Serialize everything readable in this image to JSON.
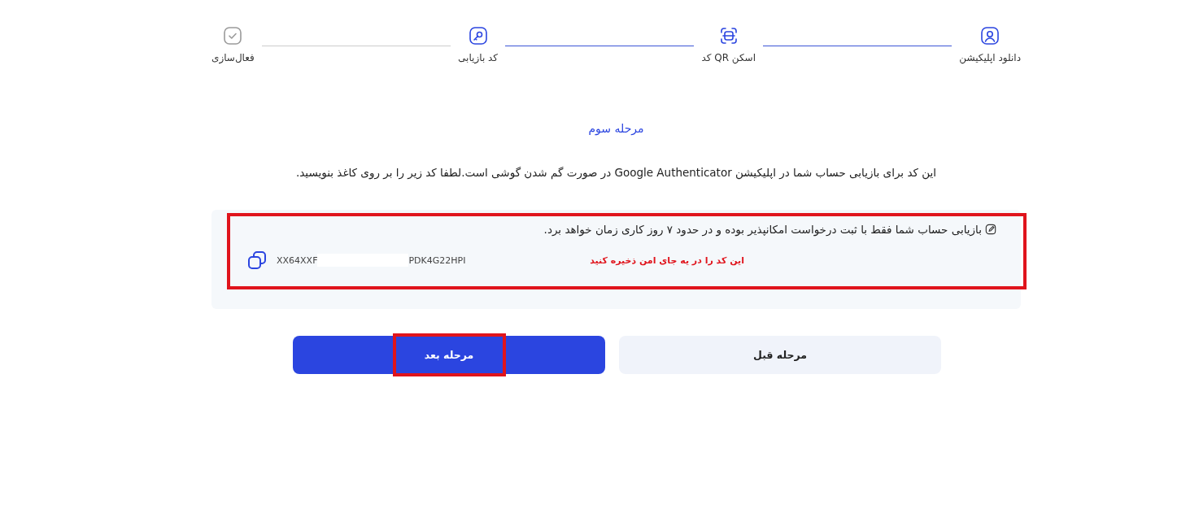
{
  "steps": [
    {
      "label": "دانلود اپلیکیشن",
      "kind": "download",
      "active": true
    },
    {
      "label": "اسکن QR کد",
      "kind": "scan",
      "active": true
    },
    {
      "label": "کد بازیابی",
      "kind": "recovery",
      "active": true
    },
    {
      "label": "فعال‌سازی",
      "kind": "activate",
      "active": false
    }
  ],
  "heading": "مرحله سوم",
  "description": "این کد برای بازیابی حساب شما در اپلیکیشن Google Authenticator در صورت گم شدن گوشی است.لطفا کد زیر را بر روی کاغذ بنویسید.",
  "notice": {
    "text": "بازیابی حساب شما فقط با ثبت درخواست امکانپذیر بوده و در حدود ۷ روز کاری زمان خواهد برد.",
    "code_start": "XX64XXF",
    "code_end": "PDK4G22HPI",
    "annotation": "این کد را در یه جای امن ذخیره کنید"
  },
  "buttons": [
    {
      "label": "مرحله قبل",
      "kind": "secondary"
    },
    {
      "label": "مرحله بعد",
      "kind": "primary"
    }
  ]
}
